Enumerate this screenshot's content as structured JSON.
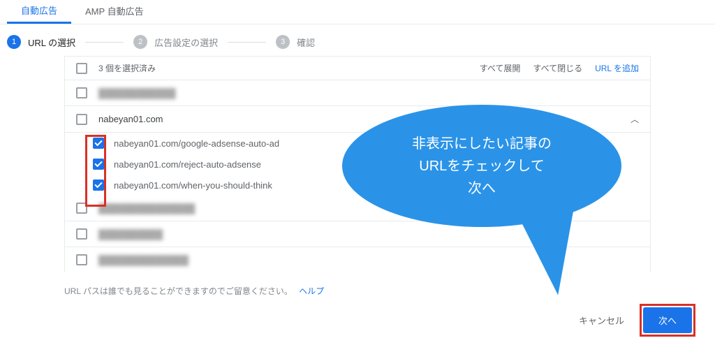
{
  "tabs": {
    "auto_ads": "自動広告",
    "amp_auto_ads": "AMP 自動広告"
  },
  "steps": {
    "s1_label": "URL の選択",
    "s2_label": "広告設定の選択",
    "s3_label": "確認"
  },
  "panel": {
    "selected_count": "3 個を選択済み",
    "expand_all": "すべて展開",
    "collapse_all": "すべて閉じる",
    "add_url": "URL を追加"
  },
  "rows": {
    "row0_label": "████████████",
    "row1_label": "nabeyan01.com",
    "row2_label": "███████████████",
    "row3_label": "██████████",
    "row4_label": "██████████████"
  },
  "subrows": {
    "s0": "nabeyan01.com/google-adsense-auto-ad",
    "s1": "nabeyan01.com/reject-auto-adsense",
    "s2": "nabeyan01.com/when-you-should-think"
  },
  "footer": {
    "note": "URL パスは誰でも見ることができますのでご留意ください。",
    "help": "ヘルプ",
    "cancel": "キャンセル",
    "next": "次へ"
  },
  "annotation": {
    "line1": "非表示にしたい記事の",
    "line2": "URLをチェックして",
    "line3": "次へ"
  },
  "colors": {
    "primary": "#1a73e8",
    "danger": "#d93025",
    "bubble": "#2a93e8"
  }
}
